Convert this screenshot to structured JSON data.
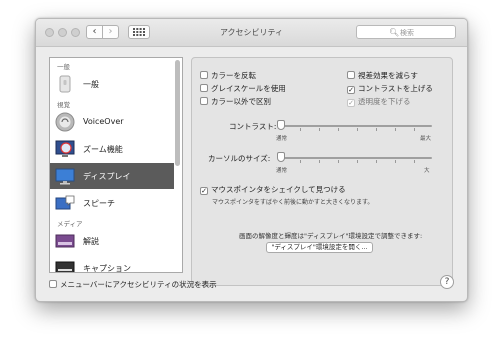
{
  "window": {
    "title": "アクセシビリティ"
  },
  "search": {
    "placeholder": "検索",
    "icon": "search-icon"
  },
  "toolbar": {
    "back": "‹",
    "forward": "›",
    "grid": "grid-icon"
  },
  "sidebar": {
    "sections": [
      "一般",
      "視覚",
      "メディア"
    ],
    "items": [
      {
        "label": "一般",
        "icon": "general-icon",
        "selected": false
      },
      {
        "label": "VoiceOver",
        "icon": "voiceover-icon",
        "selected": false
      },
      {
        "label": "ズーム機能",
        "icon": "zoom-icon",
        "selected": false
      },
      {
        "label": "ディスプレイ",
        "icon": "display-icon",
        "selected": true
      },
      {
        "label": "スピーチ",
        "icon": "speech-icon",
        "selected": false
      },
      {
        "label": "解説",
        "icon": "descriptions-icon",
        "selected": false
      },
      {
        "label": "キャプション",
        "icon": "captions-icon",
        "selected": false
      }
    ]
  },
  "display": {
    "left_options": [
      {
        "label": "カラーを反転",
        "checked": false
      },
      {
        "label": "グレイスケールを使用",
        "checked": false
      },
      {
        "label": "カラー以外で区別",
        "checked": false
      }
    ],
    "right_options": [
      {
        "label": "視差効果を減らす",
        "checked": false,
        "enabled": true
      },
      {
        "label": "コントラストを上げる",
        "checked": true,
        "enabled": true
      },
      {
        "label": "透明度を下げる",
        "checked": true,
        "enabled": false
      }
    ],
    "contrast": {
      "label": "コントラスト:",
      "min_label": "通常",
      "max_label": "最大",
      "value": 0
    },
    "cursor_size": {
      "label": "カーソルのサイズ:",
      "min_label": "通常",
      "max_label": "大",
      "value": 0
    },
    "shake": {
      "label": "マウスポインタをシェイクして見つける",
      "checked": true,
      "description": "マウスポインタをすばやく前後に動かすと大きくなります。"
    },
    "resolution_note": "画面の解像度と輝度は\"ディスプレイ\"環境設定で調整できます:",
    "open_button": "\"ディスプレイ\"環境設定を開く..."
  },
  "footer": {
    "menubar_checkbox": "メニューバーにアクセシビリティの状況を表示",
    "menubar_checked": false,
    "help": "?"
  },
  "colors": {
    "selection": "#5b5b5b",
    "window_bg": "#ececec"
  }
}
